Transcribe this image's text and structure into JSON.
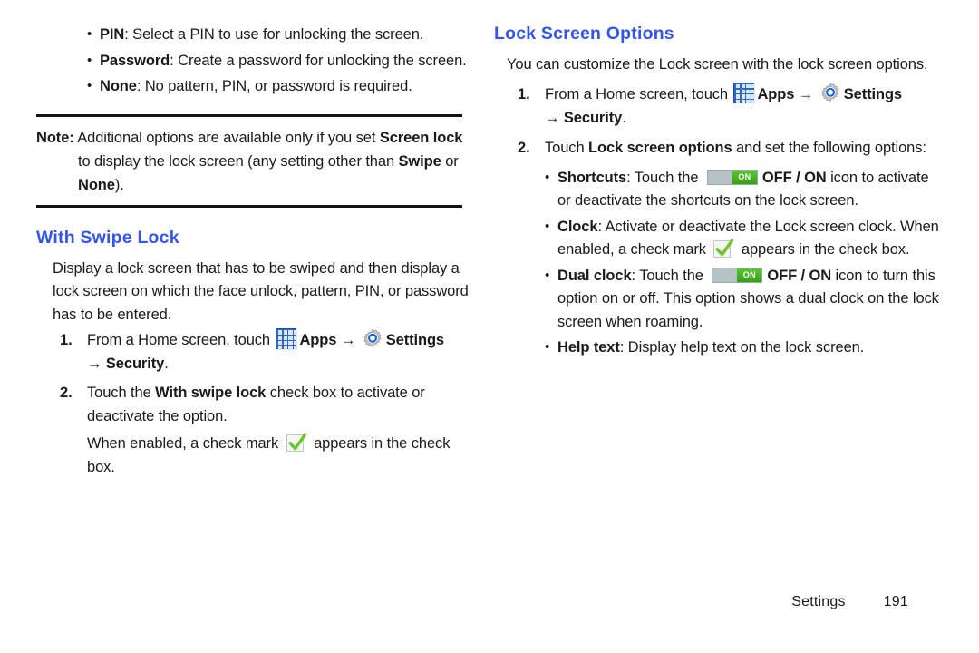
{
  "document": {
    "footer": {
      "section": "Settings",
      "page_number": "191"
    },
    "colors": {
      "heading_blue": "#3355ee",
      "toggle_green": "#4fb82b",
      "check_green": "#6ec72a",
      "apps_icon_blue": "#2f66c8"
    }
  },
  "left_column": {
    "bullets": [
      {
        "term": "PIN",
        "text": ": Select a PIN to use for unlocking the screen."
      },
      {
        "term": "Password",
        "text": ": Create a password for unlocking the screen."
      },
      {
        "term": "None",
        "text": ": No pattern, PIN, or password is required."
      }
    ],
    "note": {
      "label": "Note:",
      "line1_a": " Additional options are available only if you set ",
      "line1_b": "Screen lock",
      "line1_c": " to display the lock screen (any setting other than ",
      "line1_d": "Swipe",
      "line1_e": " or ",
      "line1_f": "None",
      "line1_g": ")."
    },
    "heading": "With Swipe Lock",
    "intro": "Display a lock screen that has to be swiped and then display a lock screen on which the face unlock, pattern, PIN, or password has to be entered.",
    "steps": [
      {
        "num": "1.",
        "pre": "From a Home screen, touch ",
        "apps_label": "Apps",
        "arrow": "→",
        "settings_label": "Settings",
        "arrow2": "→",
        "security_label": "Security",
        "period": "."
      },
      {
        "num": "2.",
        "pre": "Touch the ",
        "bold": "With swipe lock",
        "post": " check box to activate or deactivate the option.",
        "extra_pre": "When enabled, a check mark ",
        "extra_post": " appears in the check box."
      }
    ]
  },
  "right_column": {
    "heading": "Lock Screen Options",
    "intro": "You can customize the Lock screen with the lock screen options.",
    "steps": [
      {
        "num": "1.",
        "pre": "From a Home screen, touch ",
        "apps_label": "Apps",
        "arrow": "→",
        "settings_label": "Settings",
        "arrow2": "→",
        "security_label": "Security",
        "period": "."
      },
      {
        "num": "2.",
        "pre": "Touch ",
        "bold": "Lock screen options",
        "post": " and set the following options:"
      }
    ],
    "options": [
      {
        "term": "Shortcuts",
        "pre": ": Touch the ",
        "toggle_label": "ON",
        "bold_mid": "OFF / ON",
        "post": " icon to activate or deactivate the shortcuts on the lock screen.",
        "kind": "toggle"
      },
      {
        "term": "Clock",
        "pre": ": Activate or deactivate the Lock screen clock. When enabled, a check mark ",
        "post": " appears in the check box.",
        "kind": "check"
      },
      {
        "term": "Dual clock",
        "pre": ": Touch the ",
        "toggle_label": "ON",
        "bold_mid": "OFF / ON",
        "post": " icon to turn this option on or off. This option shows a dual clock on the lock screen when roaming.",
        "kind": "toggle"
      },
      {
        "term": "Help text",
        "pre": ": Display help text on the lock screen.",
        "kind": "plain"
      }
    ]
  }
}
